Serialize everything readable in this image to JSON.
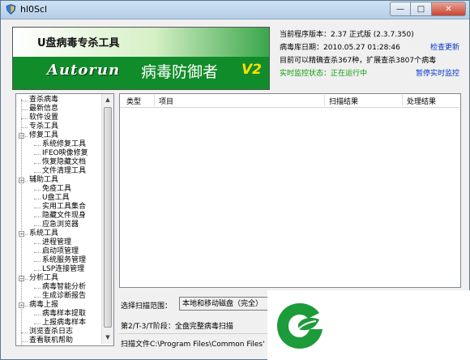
{
  "window": {
    "title": "hl0Scl",
    "min": "—",
    "max": "□",
    "close": "✕"
  },
  "banner": {
    "product_name": "U盘病毒专杀工具",
    "logo_text": "Autorun",
    "slogan": "病毒防御者",
    "version_mark": "V2"
  },
  "info": {
    "version_label": "当前程序版本：",
    "version_value": "2.37 正式版 (2.3.7.350)",
    "db_label": "病毒库日期：",
    "db_value": "2010.05.27 01:28:46",
    "check_update": "检查更新",
    "detect_text": "目前可以精确查杀367种，扩展查杀3807个病毒",
    "monitor_label": "实时监控状态：正在运行中",
    "pause_monitor": "暂停实时监控"
  },
  "tree": [
    {
      "label": "查杀病毒",
      "level": 0
    },
    {
      "label": "最新信息",
      "level": 0
    },
    {
      "label": "软件设置",
      "level": 0
    },
    {
      "label": "专杀工具",
      "level": 0
    },
    {
      "label": "修复工具",
      "level": 0,
      "toggle": "−"
    },
    {
      "label": "系统修复工具",
      "level": 1
    },
    {
      "label": "IFEO映像修复",
      "level": 1
    },
    {
      "label": "恢复隐藏文档",
      "level": 1
    },
    {
      "label": "文件清理工具",
      "level": 1
    },
    {
      "label": "辅助工具",
      "level": 0,
      "toggle": "−"
    },
    {
      "label": "免疫工具",
      "level": 1
    },
    {
      "label": "U盘工具",
      "level": 1
    },
    {
      "label": "实用工具集合",
      "level": 1
    },
    {
      "label": "隐藏文件现身",
      "level": 1
    },
    {
      "label": "应急浏览器",
      "level": 1
    },
    {
      "label": "系统工具",
      "level": 0,
      "toggle": "−"
    },
    {
      "label": "进程管理",
      "level": 1
    },
    {
      "label": "启动项管理",
      "level": 1
    },
    {
      "label": "系统服务管理",
      "level": 1
    },
    {
      "label": "LSP连接管理",
      "level": 1
    },
    {
      "label": "分析工具",
      "level": 0,
      "toggle": "−"
    },
    {
      "label": "病毒智能分析",
      "level": 1
    },
    {
      "label": "生成诊断报告",
      "level": 1
    },
    {
      "label": "病毒上报",
      "level": 0,
      "toggle": "−"
    },
    {
      "label": "病毒样本提取",
      "level": 1
    },
    {
      "label": "上报病毒样本",
      "level": 1
    },
    {
      "label": "浏览查杀日志",
      "level": 0
    },
    {
      "label": "查看联机帮助",
      "level": 0
    }
  ],
  "results": {
    "columns": [
      "类型",
      "项目",
      "扫描结果",
      "处理结果"
    ]
  },
  "scan": {
    "scope_label": "选择扫描范围：",
    "scope_value": "本地和移动磁盘（完全）",
    "phase": "第2/T-3/T阶段：全盘完整病毒扫描",
    "scanning_file": "扫描文件C:\\Program Files\\Common Files'"
  },
  "icons": {
    "app": "shield-icon",
    "overlay": "leaf-logo-icon"
  },
  "colors": {
    "accent_green": "#0c9a0c",
    "link_blue": "#0033cc",
    "banner_green": "#118c2a",
    "version_yellow": "#ffe000"
  }
}
